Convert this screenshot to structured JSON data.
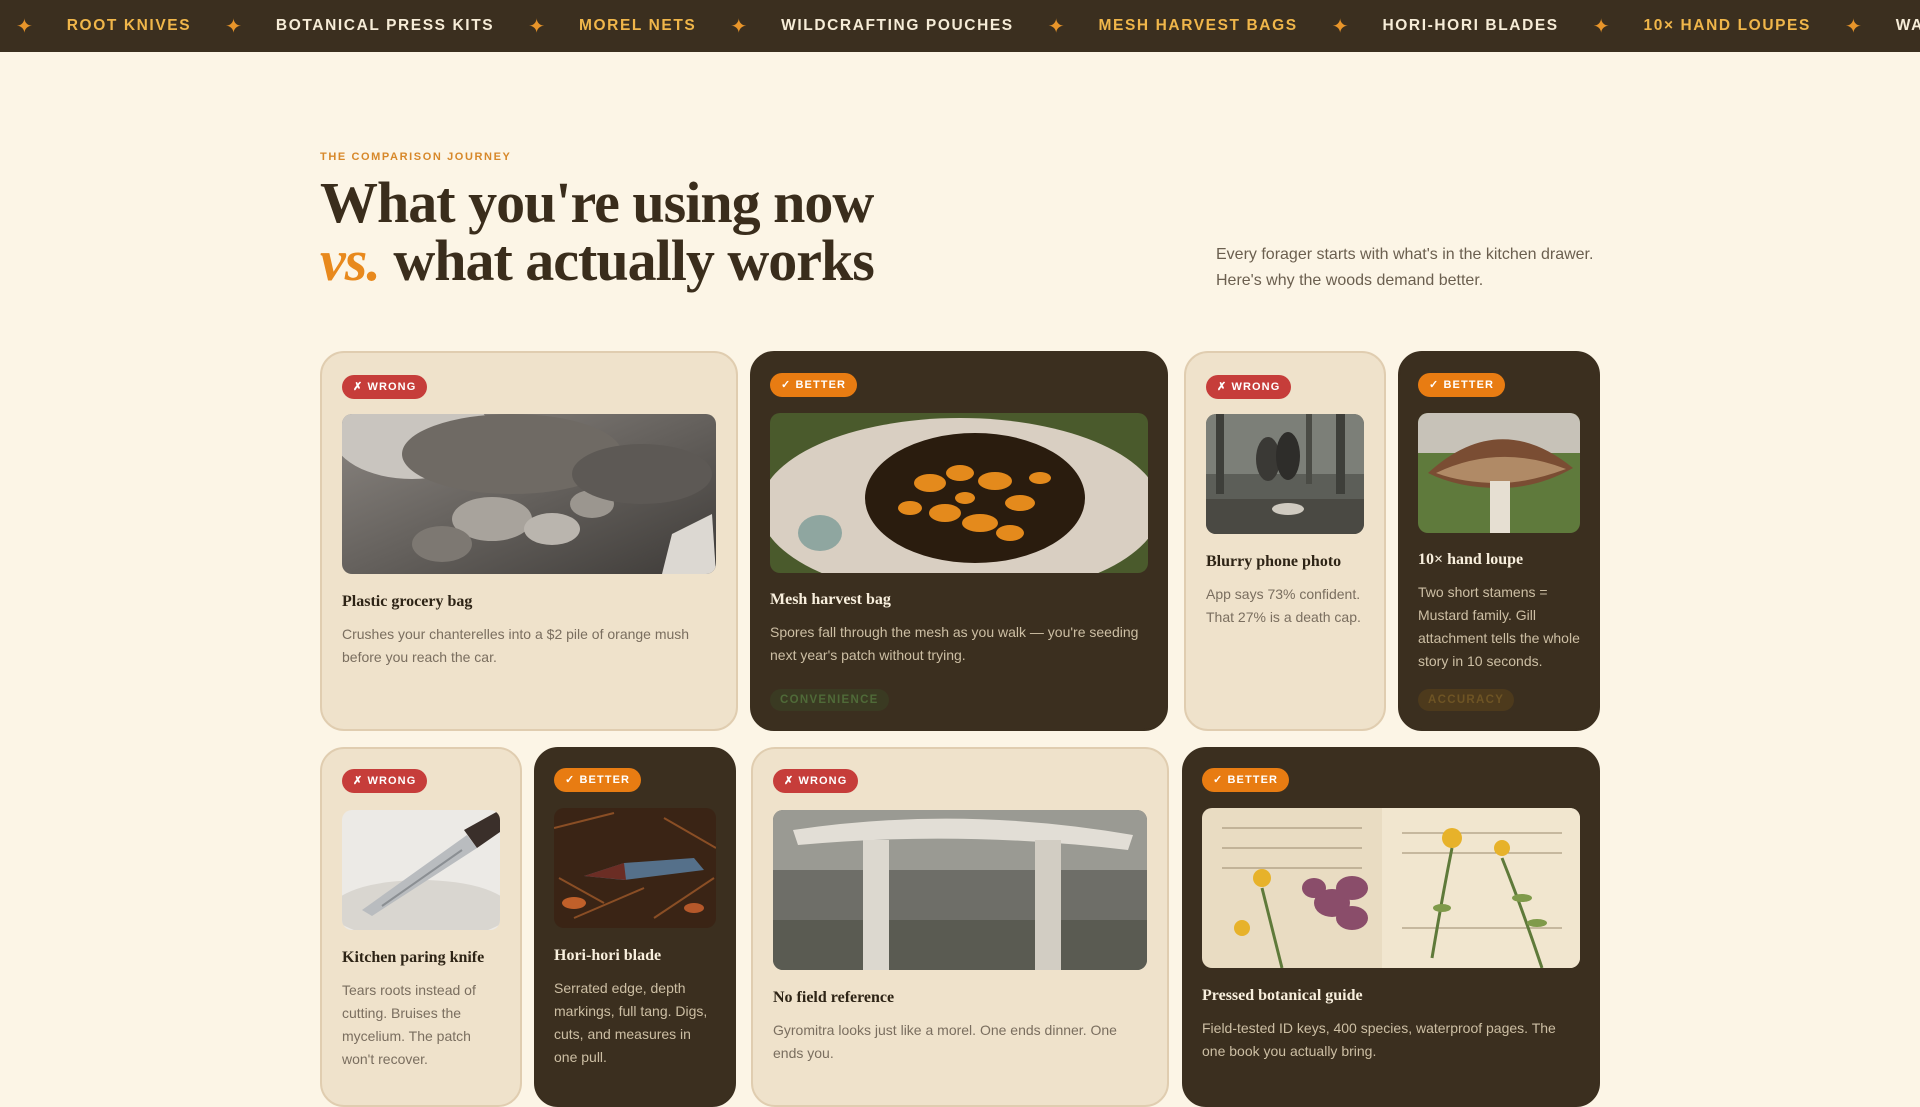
{
  "marquee": {
    "items": [
      {
        "label": "ROOT KNIVES",
        "tone": "gold"
      },
      {
        "label": "BOTANICAL PRESS KITS",
        "tone": "light"
      },
      {
        "label": "MOREL NETS",
        "tone": "gold"
      },
      {
        "label": "WILDCRAFTING POUCHES",
        "tone": "light"
      },
      {
        "label": "MESH HARVEST BAGS",
        "tone": "gold"
      },
      {
        "label": "HORI-HORI BLADES",
        "tone": "light"
      },
      {
        "label": "10× HAND LOUPES",
        "tone": "gold"
      },
      {
        "label": "WAXED CANVAS SA",
        "tone": "light"
      }
    ],
    "separator": "✦"
  },
  "section": {
    "eyebrow": "THE COMPARISON JOURNEY",
    "headline_line1": "What you're using now",
    "headline_vs": "vs.",
    "headline_line2": " what actually works",
    "intro_line1": "Every forager starts with what's in the kitchen drawer.",
    "intro_line2": "Here's why the woods demand better."
  },
  "cards": {
    "plastic_bag": {
      "badge": "✗ WRONG",
      "title": "Plastic grocery bag",
      "desc_1": "Crushes your chanterelles into a $2 pile of orange mush",
      "desc_2": "before you reach the car.",
      "icon": "mushroom-pile-photo"
    },
    "mesh_bag": {
      "badge": "✓ BETTER",
      "title": "Mesh harvest bag",
      "desc_1": "Spores fall through the mesh as you walk — you're seeding",
      "desc_2": "next year's patch without trying.",
      "tag": "CONVENIENCE",
      "icon": "chanterelles-in-mesh-photo"
    },
    "blurry_photo": {
      "badge": "✗ WRONG",
      "title": "Blurry phone photo",
      "desc_1": "App says 73% confident.",
      "desc_2": "That 27% is a death cap.",
      "icon": "forest-walkers-photo"
    },
    "hand_loupe": {
      "badge": "✓ BETTER",
      "title": "10× hand loupe",
      "desc_1": "Two short stamens =",
      "desc_2": "Mustard family. Gill",
      "desc_3": "attachment tells the whole",
      "desc_4": "story in 10 seconds.",
      "tag": "ACCURACY",
      "icon": "mushroom-gills-photo"
    },
    "paring_knife": {
      "badge": "✗ WRONG",
      "title": "Kitchen paring knife",
      "desc_1": "Tears roots instead of",
      "desc_2": "cutting. Bruises the",
      "desc_3": "mycelium. The patch",
      "desc_4": "won't recover.",
      "icon": "paring-knife-photo"
    },
    "hori_hori": {
      "badge": "✓ BETTER",
      "title": "Hori-hori blade",
      "desc_1": "Serrated edge, depth",
      "desc_2": "markings, full tang. Digs,",
      "desc_3": "cuts, and measures in",
      "desc_4": "one pull.",
      "icon": "hori-hori-photo"
    },
    "no_reference": {
      "badge": "✗ WRONG",
      "title": "No field reference",
      "desc_1": "Gyromitra looks just like a morel. One ends dinner. One",
      "desc_2": "ends you.",
      "icon": "mushroom-stems-photo"
    },
    "botanical_guide": {
      "badge": "✓ BETTER",
      "title": "Pressed botanical guide",
      "desc_1": "Field-tested ID keys, 400 species, waterproof pages. The",
      "desc_2": "one book you actually bring.",
      "icon": "pressed-flowers-photo"
    }
  },
  "colors": {
    "background": "#fcf5e6",
    "dark": "#3b2f1f",
    "accent": "#e8891d",
    "wrong": "#c63d3a",
    "better": "#e87c12"
  }
}
